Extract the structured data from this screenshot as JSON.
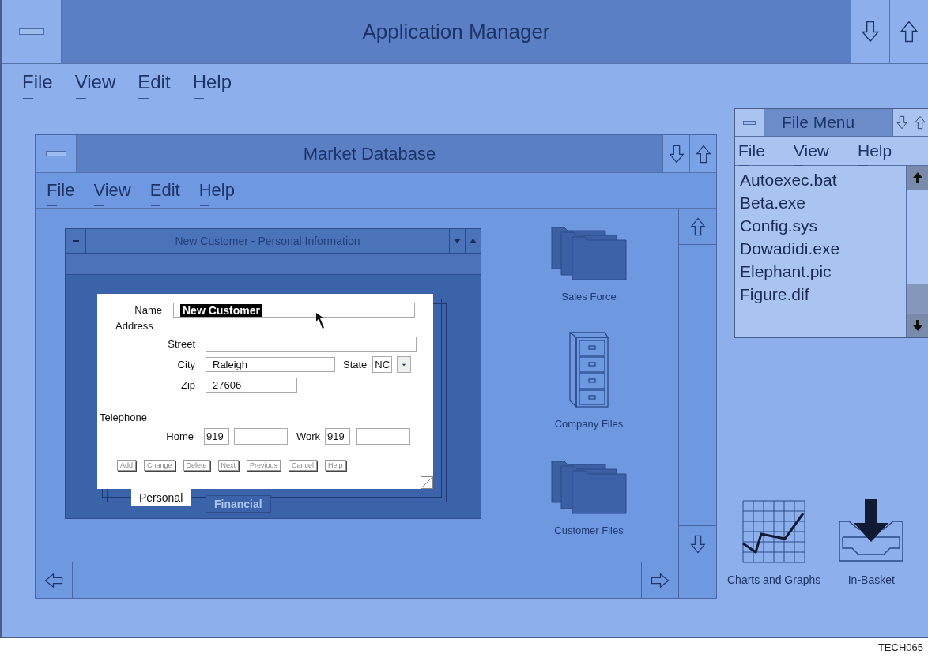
{
  "app_window": {
    "title": "Application Manager",
    "menu": [
      {
        "label": "File"
      },
      {
        "label": "View"
      },
      {
        "label": "Edit"
      },
      {
        "label": "Help"
      }
    ]
  },
  "market_database": {
    "title": "Market Database",
    "menu": [
      {
        "label": "File"
      },
      {
        "label": "View"
      },
      {
        "label": "Edit"
      },
      {
        "label": "Help"
      }
    ],
    "icons": [
      {
        "kind": "folders",
        "label": "Sales Force"
      },
      {
        "kind": "cabinet",
        "label": "Company Files"
      },
      {
        "kind": "folders",
        "label": "Customer Files"
      }
    ]
  },
  "customer_window": {
    "title": "New Customer - Personal Information",
    "form": {
      "name": {
        "label": "Name",
        "value": "New Customer",
        "highlighted": true
      },
      "address_heading": "Address",
      "street": {
        "label": "Street"
      },
      "city": {
        "label": "City",
        "value": "Raleigh"
      },
      "state": {
        "label": "State",
        "value": "NC"
      },
      "zip": {
        "label": "Zip",
        "value": "27606"
      },
      "telephone_heading": "Telephone",
      "home": {
        "label": "Home",
        "area_code": "919"
      },
      "work": {
        "label": "Work",
        "area_code": "919"
      }
    },
    "buttons": [
      "Add",
      "Change",
      "Delete",
      "Next",
      "Previous",
      "Cancel",
      "Help"
    ],
    "tabs": [
      {
        "label": "Personal",
        "selected": true
      },
      {
        "label": "Financial",
        "selected": false
      }
    ]
  },
  "file_menu": {
    "title": "File Menu",
    "menu": [
      {
        "label": "File"
      },
      {
        "label": "View"
      },
      {
        "label": "Help"
      }
    ],
    "files": [
      "Autoexec.bat",
      "Beta.exe",
      "Config.sys",
      "Dowadidi.exe",
      "Elephant.pic",
      "Figure.dif"
    ]
  },
  "desktop_icons": [
    {
      "kind": "chart",
      "label": "Charts and Graphs"
    },
    {
      "kind": "inbasket",
      "label": "In-Basket"
    }
  ],
  "figure_id": "TECH065"
}
